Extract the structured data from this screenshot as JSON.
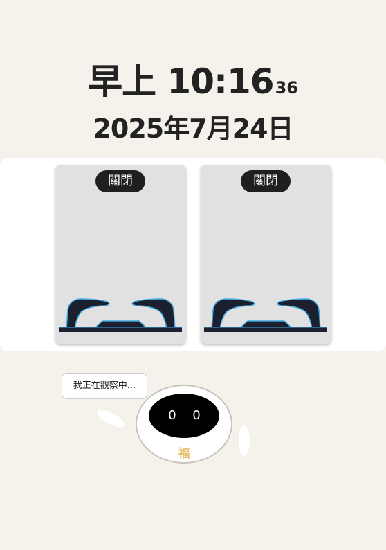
{
  "clock": {
    "period": "早上",
    "time": "10:16",
    "seconds": "36"
  },
  "date": "2025年7月24日",
  "cards": [
    {
      "status": "關閉"
    },
    {
      "status": "關閉"
    }
  ],
  "assistant": {
    "speech": "我正在觀察中...",
    "badge": "福",
    "eyes": [
      "0",
      "0"
    ]
  },
  "colors": {
    "background": "#f5f1eb",
    "card": "#e1e1e1",
    "badge_bg": "#1f1f1f",
    "slipper": "#1b1f2e",
    "slipper_edge": "#3fa9e0",
    "robot_label": "#e8c06a"
  }
}
